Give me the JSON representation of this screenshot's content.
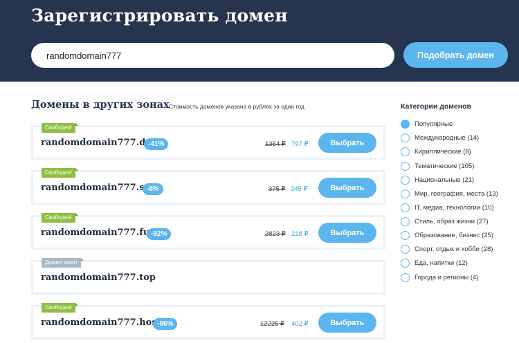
{
  "header": {
    "title": "Зарегистрировать домен",
    "search_value": "randomdomain777",
    "search_button": "Подобрать домен"
  },
  "main": {
    "section_title": "Домены в других зонах",
    "section_note": "Стоимость доменов указана в рублях за один год",
    "domains": [
      {
        "status": "Свободен!",
        "name": "randomdomain777.de",
        "discount": "-41%",
        "old_price": "1354 ₽",
        "new_price": "797 ₽",
        "button": "Выбрать"
      },
      {
        "status": "Свободен!",
        "name": "randomdomain777.su",
        "discount": "-8%",
        "old_price": "375 ₽",
        "new_price": "345 ₽",
        "button": "Выбрать"
      },
      {
        "status": "Свободен!",
        "name": "randomdomain777.fun",
        "discount": "-92%",
        "old_price": "2823 ₽",
        "new_price": "218 ₽",
        "button": "Выбрать"
      },
      {
        "status": "Домен занят",
        "name": "randomdomain777.top"
      },
      {
        "status": "Свободен!",
        "name": "randomdomain777.host",
        "discount": "-96%",
        "old_price": "12225 ₽",
        "new_price": "402 ₽",
        "button": "Выбрать"
      }
    ]
  },
  "sidebar": {
    "title": "Категории доменов",
    "categories": [
      {
        "label": "Популярные",
        "checked": true
      },
      {
        "label": "Международные (14)"
      },
      {
        "label": "Кириллические (8)"
      },
      {
        "label": "Тематические (105)"
      },
      {
        "label": "Национальные (21)"
      },
      {
        "label": "Мир, география, места (13)"
      },
      {
        "label": "IT, медиа, технологии (10)"
      },
      {
        "label": "Стиль, образ жизни (27)"
      },
      {
        "label": "Образование, бизнес (25)"
      },
      {
        "label": "Спорт, отдых и хобби (28)"
      },
      {
        "label": "Еда, напитки (12)"
      },
      {
        "label": "Города и регионы (4)"
      }
    ]
  },
  "colors": {
    "header_bg": "#25344f",
    "accent": "#5bb5ee",
    "free_badge": "#8fbf43",
    "taken_badge": "#a9b8c6"
  }
}
